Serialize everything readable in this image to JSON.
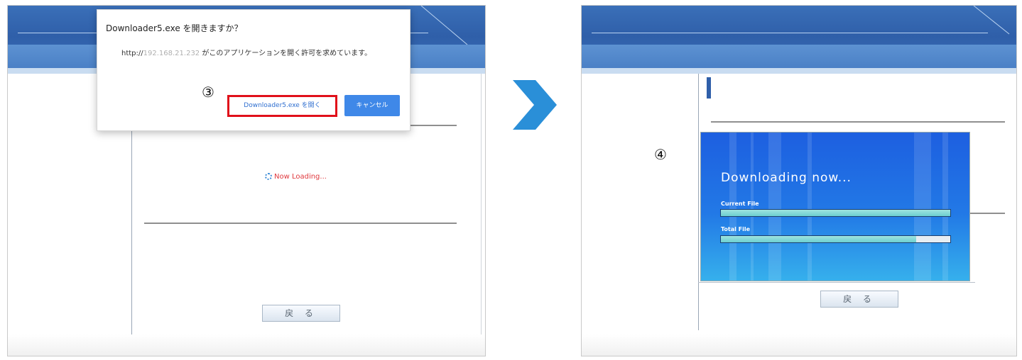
{
  "left_screen": {
    "dialog": {
      "title": "Downloader5.exe を開きますか？",
      "message_prefix": "http://",
      "message_blurred": "192.168.21.232",
      "message_suffix": " がこのアプリケーションを開く許可を求めています。",
      "open_button": "Downloader5.exe を開く",
      "cancel_button": "キャンセル"
    },
    "step_marker": "③",
    "loading_text": "Now Loading...",
    "back_button": "戻 る"
  },
  "right_screen": {
    "step_marker": "④",
    "downloader": {
      "title": "Downloading now...",
      "current_label": "Current File",
      "current_progress": 1.0,
      "total_label": "Total File",
      "total_progress": 0.85
    },
    "back_button": "戻 る"
  },
  "colors": {
    "header": "#2f5fa9",
    "highlight": "#e0101a",
    "arrow": "#2a8fd8",
    "download_bg": "#1d5fe0"
  }
}
